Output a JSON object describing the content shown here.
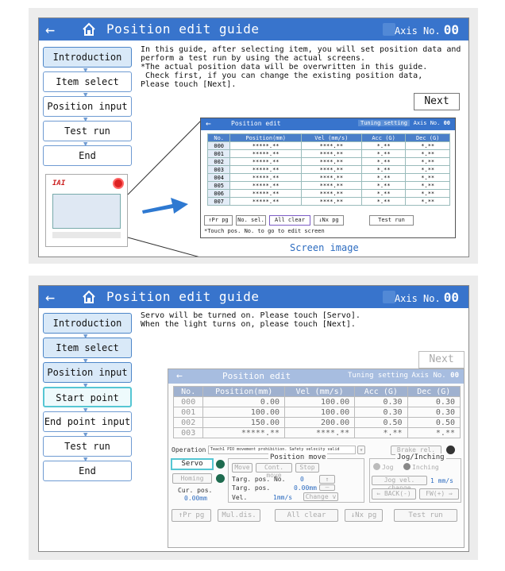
{
  "top": {
    "back_icon": "←",
    "title": "Position edit guide",
    "axis_label": "Axis No.",
    "axis_no": "00",
    "nav": [
      "Introduction",
      "Item select",
      "Position input",
      "Test run",
      "End"
    ],
    "message": "In this guide, after selecting item, you will set position data and\nperform a test run by using the actual screens.\n*The actual position data will be overwritten in this guide.\n Check first, if you can change the existing position data,\nPlease touch [Next].",
    "next_label": "Next",
    "thumb_logo": "IAI",
    "screen_image_label": "Screen image",
    "mini": {
      "title": "Position edit",
      "tuning": "Tuning setting",
      "axis_label": "Axis No.",
      "axis_no": "00",
      "headers": [
        "No.",
        "Position(mm)",
        "Vel (mm/s)",
        "Acc (G)",
        "Dec (G)"
      ],
      "rows": [
        [
          "000",
          "*****.**",
          "****.**",
          "*.**",
          "*.**"
        ],
        [
          "001",
          "*****.**",
          "****.**",
          "*.**",
          "*.**"
        ],
        [
          "002",
          "*****.**",
          "****.**",
          "*.**",
          "*.**"
        ],
        [
          "003",
          "*****.**",
          "****.**",
          "*.**",
          "*.**"
        ],
        [
          "004",
          "*****.**",
          "****.**",
          "*.**",
          "*.**"
        ],
        [
          "005",
          "*****.**",
          "****.**",
          "*.**",
          "*.**"
        ],
        [
          "006",
          "*****.**",
          "****.**",
          "*.**",
          "*.**"
        ],
        [
          "007",
          "*****.**",
          "****.**",
          "*.**",
          "*.**"
        ]
      ],
      "buttons": [
        "↑Pr pg",
        "No. sel.",
        "All clear",
        "↓Nx pg",
        "Test run"
      ],
      "hint": "*Touch pos. No. to go to edit screen"
    }
  },
  "bottom": {
    "back_icon": "←",
    "title": "Position edit guide",
    "axis_label": "Axis No.",
    "axis_no": "00",
    "nav": [
      "Introduction",
      "Item select",
      "Position input",
      "Start point input",
      "End point input",
      "Test run",
      "End"
    ],
    "message": "Servo will be turned on. Please touch [Servo].\nWhen the light turns on, please touch [Next].",
    "next_label": "Next",
    "pos": {
      "title": "Position edit",
      "tuning": "Tuning setting",
      "axis_label": "Axis No.",
      "axis_no": "00",
      "headers": [
        "No.",
        "Position(mm)",
        "Vel (mm/s)",
        "Acc (G)",
        "Dec (G)"
      ],
      "rows": [
        [
          "000",
          "0.00",
          "100.00",
          "0.30",
          "0.30"
        ],
        [
          "001",
          "100.00",
          "100.00",
          "0.30",
          "0.30"
        ],
        [
          "002",
          "150.00",
          "200.00",
          "0.50",
          "0.50"
        ],
        [
          "003",
          "*****.**",
          "****.**",
          "*.**",
          "*.**"
        ]
      ],
      "operation_label": "Operation",
      "operation_value": "Teach1 PIO movement prohibition. Safety velocity valid",
      "brake_rel": "Brake rel.",
      "servo": "Servo",
      "homing": "Homing",
      "position_move": "Position move",
      "move": "Move",
      "cont_move": "Cont. move",
      "stop": "Stop",
      "targ_pos_no_label": "Targ. pos. No.",
      "targ_pos_no": "0",
      "targ_pos_label": "Targ. pos.",
      "targ_pos": "0.00mm",
      "cur_pos_label": "Cur. pos.",
      "cur_pos": "0.00mm",
      "vel_label": "Vel.",
      "vel": "1mm/s",
      "change": "Change v",
      "jog_title": "Jog/Inching",
      "jog": "Jog",
      "inching": "Inching",
      "jog_vel_change": "Jog vel. change",
      "jog_speed": "1 mm/s",
      "back_minus": "BACK(-)",
      "fw_plus": "FW(+)",
      "buttons": [
        "↑Pr pg",
        "Mul.dis.",
        "All clear",
        "↓Nx pg",
        "Test run"
      ]
    }
  },
  "colors": {
    "header_blue": "#3874cc",
    "selected_nav": "#d9e9f8",
    "servo_highlight": "#56c6d3",
    "servo_lamp": "#1e6b4f"
  }
}
